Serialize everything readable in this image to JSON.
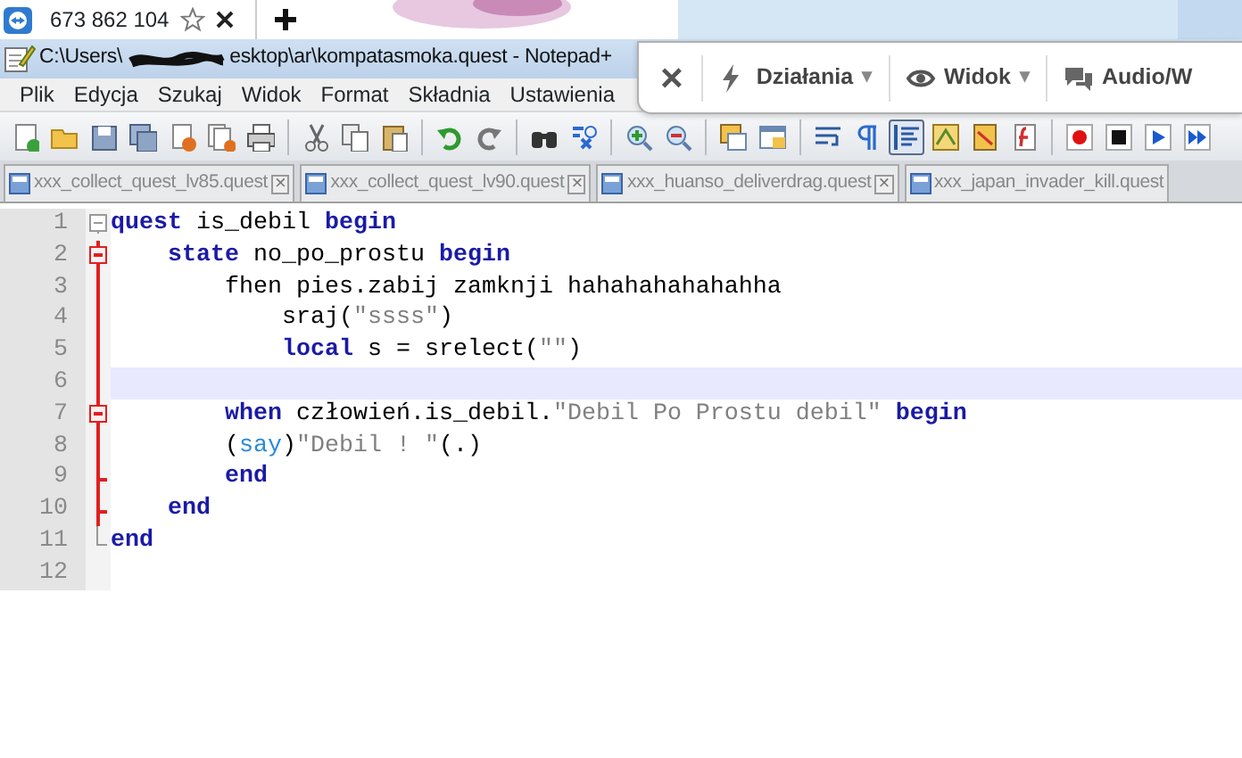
{
  "browser_tab": {
    "label": "673 862 104"
  },
  "window": {
    "title_start": "C:\\Users\\",
    "title_end": "esktop\\ar\\kompatasmoka.quest - Notepad+"
  },
  "menu": [
    "Plik",
    "Edycja",
    "Szukaj",
    "Widok",
    "Format",
    "Składnia",
    "Ustawienia"
  ],
  "remote_bar": {
    "close": "×",
    "items": [
      {
        "kind": "bolt",
        "label": "Działania",
        "caret": "▾"
      },
      {
        "kind": "eye",
        "label": "Widok",
        "caret": "▾"
      },
      {
        "kind": "chat",
        "label": "Audio/W"
      }
    ]
  },
  "toolbar": [
    {
      "kind": "new",
      "pressed": false
    },
    {
      "kind": "open",
      "pressed": false
    },
    {
      "kind": "save",
      "pressed": false
    },
    {
      "kind": "saveall",
      "pressed": false
    },
    {
      "kind": "close",
      "pressed": false
    },
    {
      "kind": "closeall",
      "pressed": false
    },
    {
      "kind": "print",
      "pressed": false
    },
    {
      "kind": "sep"
    },
    {
      "kind": "cut",
      "pressed": false
    },
    {
      "kind": "copy",
      "pressed": false
    },
    {
      "kind": "paste",
      "pressed": false
    },
    {
      "kind": "sep"
    },
    {
      "kind": "undo",
      "pressed": false
    },
    {
      "kind": "redo",
      "pressed": false
    },
    {
      "kind": "sep"
    },
    {
      "kind": "find",
      "pressed": false
    },
    {
      "kind": "replace",
      "pressed": false
    },
    {
      "kind": "sep"
    },
    {
      "kind": "zoomin",
      "pressed": false
    },
    {
      "kind": "zoomout",
      "pressed": false
    },
    {
      "kind": "sep"
    },
    {
      "kind": "syncv",
      "pressed": false
    },
    {
      "kind": "synch",
      "pressed": false
    },
    {
      "kind": "sep"
    },
    {
      "kind": "wrap",
      "pressed": false
    },
    {
      "kind": "pilcrow",
      "pressed": false
    },
    {
      "kind": "guide",
      "pressed": true
    },
    {
      "kind": "udl",
      "pressed": false
    },
    {
      "kind": "map",
      "pressed": false
    },
    {
      "kind": "func",
      "pressed": false
    },
    {
      "kind": "sep"
    },
    {
      "kind": "record",
      "pressed": false
    },
    {
      "kind": "stop",
      "pressed": false
    },
    {
      "kind": "play",
      "pressed": false
    },
    {
      "kind": "playmany",
      "pressed": false
    }
  ],
  "file_tabs": [
    {
      "label": "xxx_collect_quest_lv85.quest",
      "close": "×",
      "selected": false
    },
    {
      "label": "xxx_collect_quest_lv90.quest",
      "close": "×",
      "selected": false
    },
    {
      "label": "xxx_huanso_deliverdrag.quest",
      "close": "×",
      "selected": false
    },
    {
      "label": "xxx_japan_invader_kill.quest",
      "selected": false
    }
  ],
  "editor": {
    "lines": [
      {
        "number": "1",
        "kind": "start",
        "active": false,
        "selected": false,
        "tokens": [
          {
            "kind": "kw",
            "text": "quest"
          },
          {
            "kind": "plain",
            "text": " is_debil "
          },
          {
            "kind": "kw",
            "text": "begin"
          }
        ]
      },
      {
        "number": "2",
        "kind": "start",
        "active": true,
        "selected": false,
        "tokens": [
          {
            "kind": "kw",
            "text": "    state"
          },
          {
            "kind": "plain",
            "text": " no_po_prostu "
          },
          {
            "kind": "kw",
            "text": "begin"
          }
        ]
      },
      {
        "number": "3",
        "kind": "body",
        "active": true,
        "selected": false,
        "tokens": [
          {
            "kind": "plain",
            "text": "        fhen pies.zabij zamknji hahahahahahahha"
          }
        ]
      },
      {
        "number": "4",
        "kind": "body",
        "active": true,
        "selected": false,
        "tokens": [
          {
            "kind": "plain",
            "text": "            sraj("
          },
          {
            "kind": "str",
            "text": "\"ssss\""
          },
          {
            "kind": "plain",
            "text": ")"
          }
        ]
      },
      {
        "number": "5",
        "kind": "body",
        "active": true,
        "selected": false,
        "tokens": [
          {
            "kind": "kw",
            "text": "            local"
          },
          {
            "kind": "plain",
            "text": " s = srelect("
          },
          {
            "kind": "str",
            "text": "\"\""
          },
          {
            "kind": "plain",
            "text": ")"
          }
        ]
      },
      {
        "number": "6",
        "kind": "body",
        "active": true,
        "selected": true
      },
      {
        "number": "7",
        "kind": "start",
        "active": true,
        "selected": false,
        "tokens": [
          {
            "kind": "kw",
            "text": "        when"
          },
          {
            "kind": "plain",
            "text": " człowień.is_debil."
          },
          {
            "kind": "str",
            "text": "\"Debil Po Prostu debil\""
          },
          {
            "kind": "kw",
            "text": " begin"
          }
        ]
      },
      {
        "number": "8",
        "kind": "body",
        "active": true,
        "selected": false,
        "tokens": [
          {
            "kind": "plain",
            "text": "        ("
          },
          {
            "kind": "fn",
            "text": "say"
          },
          {
            "kind": "plain",
            "text": ")"
          },
          {
            "kind": "str",
            "text": "\"Debil ! \""
          },
          {
            "kind": "plain",
            "text": "(.)"
          }
        ]
      },
      {
        "number": "9",
        "kind": "end",
        "active": true,
        "selected": false,
        "tokens": [
          {
            "kind": "kw",
            "text": "        end"
          }
        ]
      },
      {
        "number": "10",
        "kind": "end",
        "active": true,
        "selected": false,
        "tokens": [
          {
            "kind": "kw",
            "text": "    end"
          }
        ]
      },
      {
        "number": "11",
        "kind": "end",
        "active": false,
        "selected": false,
        "tokens": [
          {
            "kind": "kw",
            "text": "end"
          }
        ]
      },
      {
        "number": "12",
        "kind": "plain",
        "selected": false
      }
    ]
  }
}
